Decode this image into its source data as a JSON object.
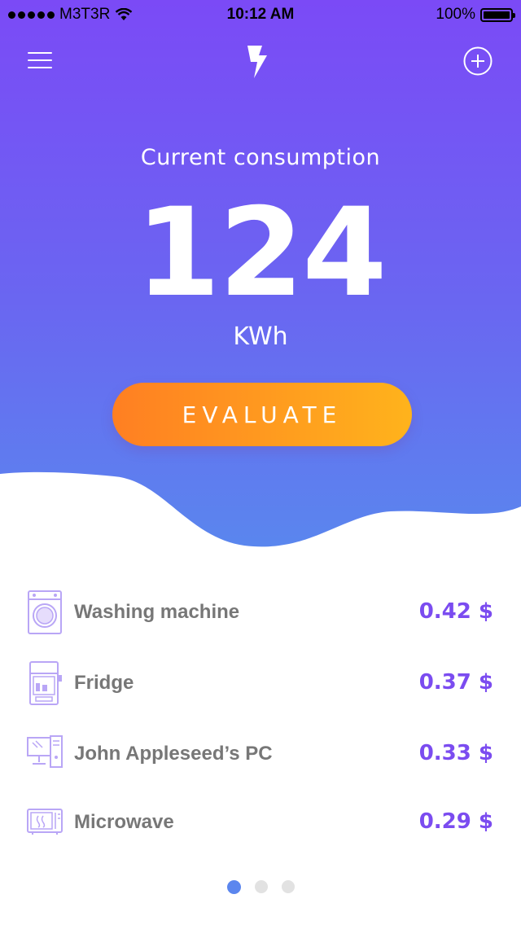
{
  "status_bar": {
    "carrier": "M3T3R",
    "time": "10:12 AM",
    "battery": "100%"
  },
  "header": {
    "menu_icon": "hamburger-icon",
    "logo_icon": "lightning-bolt-icon",
    "add_icon": "plus-circle-icon"
  },
  "consumption": {
    "label": "Current consumption",
    "value": "124",
    "unit": "KWh"
  },
  "evaluate_button": {
    "label": "EVALUATE"
  },
  "devices": [
    {
      "icon": "washing-machine-icon",
      "name": "Washing machine",
      "cost": "0.42 $"
    },
    {
      "icon": "fridge-icon",
      "name": "Fridge",
      "cost": "0.37 $"
    },
    {
      "icon": "pc-icon",
      "name": "John Appleseed’s PC",
      "cost": "0.33 $"
    },
    {
      "icon": "microwave-icon",
      "name": "Microwave",
      "cost": "0.29 $"
    }
  ],
  "pager": {
    "pages": 3,
    "active": 0
  },
  "colors": {
    "gradient_top": "#7b4cf5",
    "gradient_bottom": "#5a86ee",
    "button_start": "#ff7f22",
    "button_end": "#ffb31c",
    "cost_text": "#7b4cf0",
    "device_text": "#777777",
    "pager_active": "#5b86ee",
    "pager_inactive": "#e2e2e2"
  }
}
